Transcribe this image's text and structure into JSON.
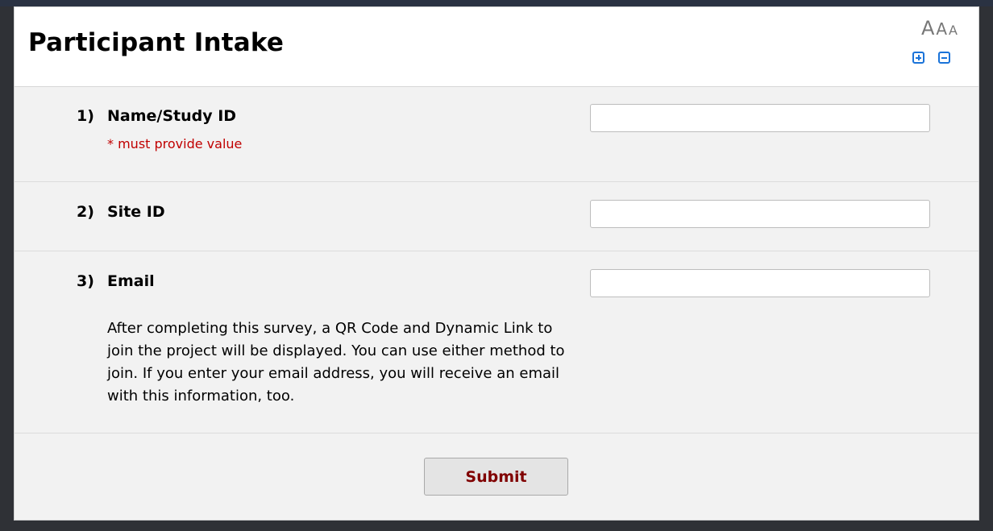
{
  "header": {
    "title": "Participant Intake",
    "font_size_glyphs": [
      "A",
      "A",
      "A"
    ],
    "zoom_in_icon": "plus-square-icon",
    "zoom_out_icon": "minus-square-icon",
    "accent_color": "#1a73d9"
  },
  "questions": [
    {
      "number": "1)",
      "label": "Name/Study ID",
      "required_note": "* must provide value",
      "value": "",
      "placeholder": ""
    },
    {
      "number": "2)",
      "label": "Site ID",
      "value": "",
      "placeholder": ""
    },
    {
      "number": "3)",
      "label": "Email",
      "note": "After completing this survey, a QR Code and Dynamic Link to join the project will be displayed. You can use either method to join. If you enter your email address, you will receive an email with this information, too.",
      "value": "",
      "placeholder": ""
    }
  ],
  "submit": {
    "label": "Submit",
    "text_color": "#800000"
  },
  "colors": {
    "required": "#c00000",
    "background": "#f2f2f2"
  }
}
